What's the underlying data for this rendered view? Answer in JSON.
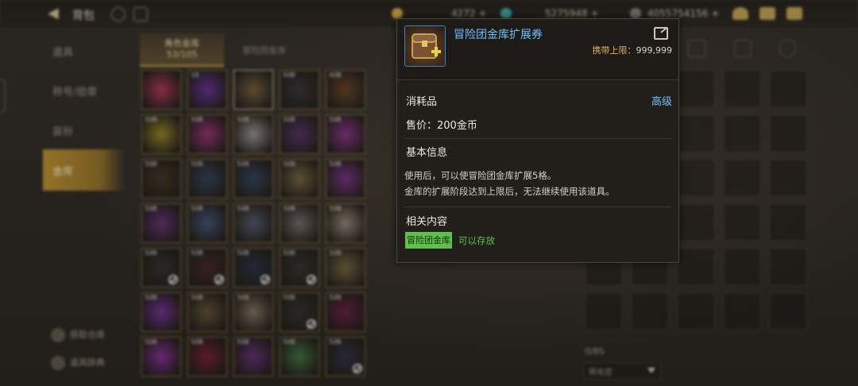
{
  "topbar": {
    "title": "背包",
    "currencies": [
      {
        "value": "4272",
        "color": "#c9a43a"
      },
      {
        "value": "5275948",
        "color": "#3aa0a0"
      },
      {
        "value": "4055754156",
        "color": "#7b7b7b"
      }
    ]
  },
  "menu": {
    "items": [
      "道具",
      "称号/勋章",
      "装扮"
    ],
    "active": "金库",
    "bottom_buttons": [
      "获取仓库",
      "道具辞典"
    ]
  },
  "storage_tabs": {
    "active_label": "角色金库",
    "active_count": "53/105",
    "other_label": "冒险团金库"
  },
  "grid": {
    "slots": [
      {
        "color": "#a03050",
        "count": "",
        "banned": false,
        "highlight": false
      },
      {
        "color": "#5a2a8a",
        "count": "18",
        "banned": false,
        "highlight": false
      },
      {
        "color": "#6a5436",
        "count": "",
        "banned": false,
        "highlight": true
      },
      {
        "color": "#2c2c30",
        "count": "50B",
        "banned": false,
        "highlight": false
      },
      {
        "color": "#5a3a20",
        "count": "40B",
        "banned": false,
        "highlight": false
      },
      {
        "color": "#8a7a20",
        "count": "50B",
        "banned": false,
        "highlight": false
      },
      {
        "color": "#8a2a6a",
        "count": "50B",
        "banned": false,
        "highlight": false
      },
      {
        "color": "#8a8a8a",
        "count": "50B",
        "banned": false,
        "highlight": false
      },
      {
        "color": "#4a2a5a",
        "count": "50B",
        "banned": false,
        "highlight": false
      },
      {
        "color": "#7a2a7a",
        "count": "50B",
        "banned": false,
        "highlight": false
      },
      {
        "color": "#3a2e1c",
        "count": "50B",
        "banned": false,
        "highlight": false
      },
      {
        "color": "#2a3850",
        "count": "50B",
        "banned": false,
        "highlight": false
      },
      {
        "color": "#2a3850",
        "count": "50B",
        "banned": false,
        "highlight": false
      },
      {
        "color": "#6a5a3a",
        "count": "50B",
        "banned": false,
        "highlight": false
      },
      {
        "color": "#6a2a7a",
        "count": "50B",
        "banned": false,
        "highlight": false
      },
      {
        "color": "#5a2a6a",
        "count": "50B",
        "banned": false,
        "highlight": false
      },
      {
        "color": "#3a4a6a",
        "count": "50B",
        "banned": false,
        "highlight": false
      },
      {
        "color": "#4a5060",
        "count": "50B",
        "banned": false,
        "highlight": false
      },
      {
        "color": "#6a6060",
        "count": "50B",
        "banned": false,
        "highlight": false
      },
      {
        "color": "#8a7a70",
        "count": "50B",
        "banned": false,
        "highlight": false
      },
      {
        "color": "#2a2a2a",
        "count": "50B",
        "banned": true,
        "highlight": false
      },
      {
        "color": "#3a2020",
        "count": "50B",
        "banned": true,
        "highlight": false
      },
      {
        "color": "#202a3a",
        "count": "50B",
        "banned": true,
        "highlight": false
      },
      {
        "color": "#2a2a2a",
        "count": "50B",
        "banned": true,
        "highlight": false
      },
      {
        "color": "#6a5a3a",
        "count": "50B",
        "banned": false,
        "highlight": false
      },
      {
        "color": "#6a2a8a",
        "count": "50B",
        "banned": false,
        "highlight": false
      },
      {
        "color": "#5a4a30",
        "count": "50B",
        "banned": false,
        "highlight": false
      },
      {
        "color": "#7a6a5a",
        "count": "50B",
        "banned": false,
        "highlight": false
      },
      {
        "color": "#2a2a2a",
        "count": "50B",
        "banned": true,
        "highlight": false
      },
      {
        "color": "#5a1a3a",
        "count": "50B",
        "banned": false,
        "highlight": false
      },
      {
        "color": "#7a2a8a",
        "count": "50B",
        "banned": false,
        "highlight": false
      },
      {
        "color": "#6a1a2a",
        "count": "50B",
        "banned": false,
        "highlight": false
      },
      {
        "color": "#5a2a6a",
        "count": "50B",
        "banned": false,
        "highlight": false
      },
      {
        "color": "#3a6a3a",
        "count": "50B",
        "banned": false,
        "highlight": false
      },
      {
        "color": "#2a2a3a",
        "count": "50B",
        "banned": true,
        "highlight": false
      }
    ]
  },
  "right_panel": {
    "count": "0/85",
    "sort_label": "稀有度"
  },
  "tooltip": {
    "name": "冒险团金库扩展券",
    "limit_label": "携带上限：",
    "limit_value": "999,999",
    "type": "消耗品",
    "grade": "高级",
    "price": "售价：200金币",
    "basic_info_title": "基本信息",
    "desc_line1": "使用后，可以使冒险团金库扩展5格。",
    "desc_line2": "金库的扩展阶段达到上限后，无法继续使用该道具。",
    "related_title": "相关内容",
    "tag": "冒险团金库",
    "tag_text": "可以存放"
  }
}
